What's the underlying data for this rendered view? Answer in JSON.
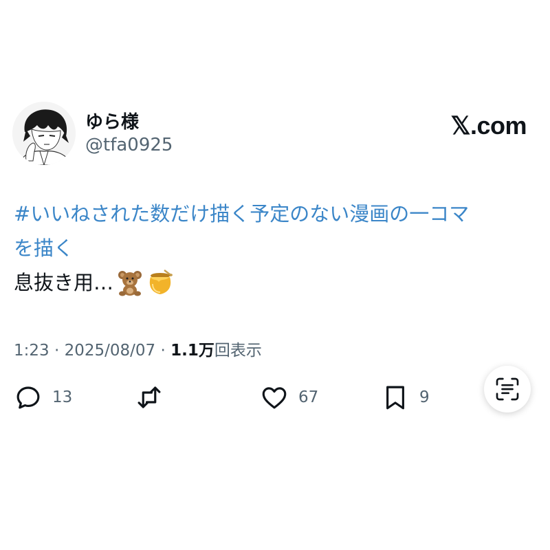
{
  "author": {
    "display_name": "ゆら様",
    "handle": "@tfa0925",
    "avatar_icon": "avatar-illustration-icon"
  },
  "site_badge": "𝕏.com",
  "tweet": {
    "hashtag_line1": "#いいねされた数だけ描く予定のない漫画の一コマ",
    "hashtag_line2": "を描く",
    "body_text": "息抜き用…",
    "emojis": [
      "teddy-bear-icon",
      "honey-pot-icon"
    ]
  },
  "meta": {
    "time": "1:23",
    "separator1": " · ",
    "date": "2025/08/07",
    "separator2": " · ",
    "views_count": "1.1万",
    "views_label": "回表示"
  },
  "actions": {
    "reply": {
      "icon": "reply-icon",
      "count": "13"
    },
    "repost": {
      "icon": "repost-icon",
      "count": ""
    },
    "like": {
      "icon": "heart-icon",
      "count": "67"
    },
    "bookmark": {
      "icon": "bookmark-icon",
      "count": "9"
    }
  },
  "lens_button": {
    "icon": "text-scan-icon"
  },
  "colors": {
    "hashtag": "#3b86c8",
    "text": "#0f1419",
    "muted": "#536471",
    "background": "#ffffff"
  }
}
